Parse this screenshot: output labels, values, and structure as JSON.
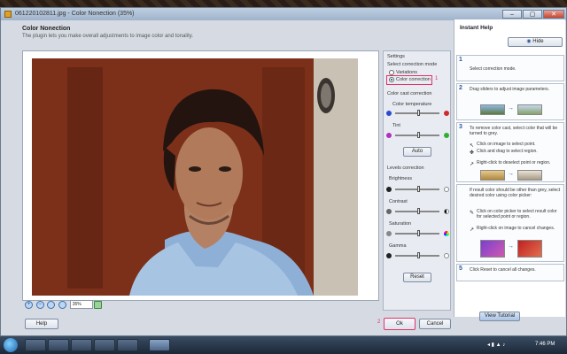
{
  "window": {
    "title": "061220102811.jpg - Color Nonection (35%)",
    "buttons": {
      "minimize": "–",
      "maximize": "▢",
      "close": "✕"
    }
  },
  "header": {
    "title": "Color Nonection",
    "subtitle": "The plugin lets you make overall adjustments to image color and tonality."
  },
  "toolbar": {
    "zoom_value": "35%"
  },
  "settings": {
    "section_title": "Settings",
    "mode_label": "Select correction mode",
    "mode_options": [
      "Variations",
      "Color correction"
    ],
    "mode_selected": "Color correction",
    "marker_1": "1",
    "cast_section": "Color cast correction",
    "color_temperature": "Color temperature",
    "tint": "Tint",
    "auto_button": "Auto",
    "levels_section": "Levels correction",
    "brightness": "Brightness",
    "contrast": "Contrast",
    "saturation": "Saturation",
    "gamma": "Gamma",
    "reset_button": "Reset"
  },
  "instant_help": {
    "title": "Instant Help",
    "hide_button": "Hide",
    "steps": [
      {
        "num": "1",
        "text": "Select correction mode."
      },
      {
        "num": "2",
        "text": "Drag sliders to adjust image parameters."
      },
      {
        "num": "3",
        "text": "To remove color cast, select color that will be turned to grey."
      },
      {
        "num": "4",
        "text": "If result color should be other than grey, select desired color using color picker:"
      },
      {
        "num": "5",
        "text": "Click Reset to cancel all changes."
      }
    ],
    "step3_bullets": [
      "Click on image to select point.",
      "Click and drag to select region.",
      "Right-click to deselect point or region."
    ],
    "step4_bullets": [
      "Click on color picker to select result color for selected point or region.",
      "Right-click on image to cancel changes."
    ],
    "view_tutorial_button": "View Tutorial"
  },
  "footer": {
    "help_button": "Help",
    "ok_button": "Ok",
    "cancel_button": "Cancel",
    "marker_2": "2"
  },
  "taskbar": {
    "time": "7:46 PM"
  },
  "colors": {
    "highlight": "#e0336a",
    "accent": "#2a5aa0"
  }
}
